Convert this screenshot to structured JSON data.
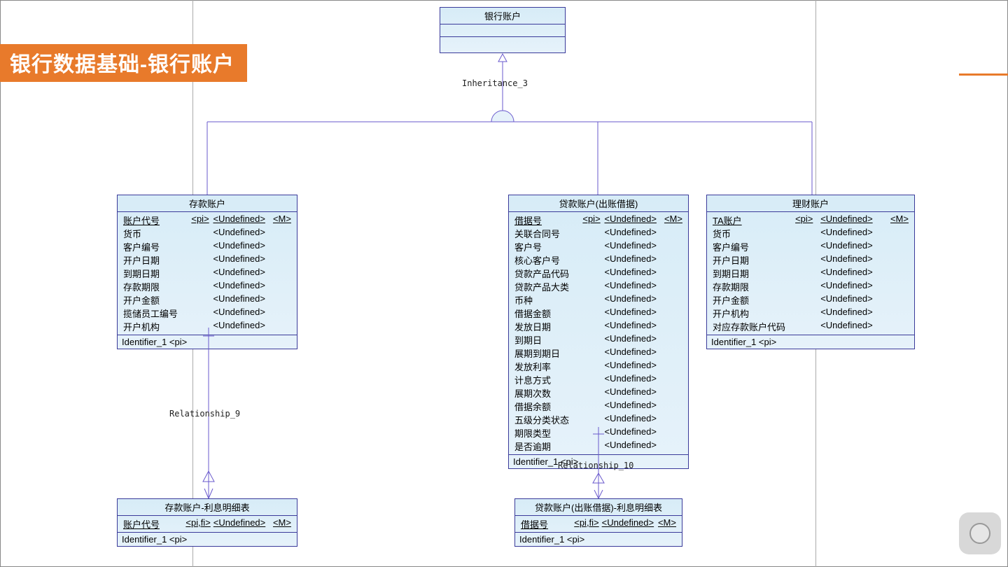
{
  "title": "银行数据基础-银行账户",
  "topEntity": {
    "name": "银行账户"
  },
  "inheritanceLabel": "Inheritance_3",
  "entities": {
    "deposit": {
      "name": "存款账户",
      "attrs": [
        {
          "name": "账户代号",
          "pi": "<pi>",
          "type": "<Undefined>",
          "m": "<M>",
          "key": true
        },
        {
          "name": "货币",
          "pi": "",
          "type": "<Undefined>",
          "m": ""
        },
        {
          "name": "客户编号",
          "pi": "",
          "type": "<Undefined>",
          "m": ""
        },
        {
          "name": "开户日期",
          "pi": "",
          "type": "<Undefined>",
          "m": ""
        },
        {
          "name": "到期日期",
          "pi": "",
          "type": "<Undefined>",
          "m": ""
        },
        {
          "name": "存款期限",
          "pi": "",
          "type": "<Undefined>",
          "m": ""
        },
        {
          "name": "开户金额",
          "pi": "",
          "type": "<Undefined>",
          "m": ""
        },
        {
          "name": "揽储员工编号",
          "pi": "",
          "type": "<Undefined>",
          "m": ""
        },
        {
          "name": "开户机构",
          "pi": "",
          "type": "<Undefined>",
          "m": ""
        }
      ],
      "ident": "Identifier_1  <pi>"
    },
    "loan": {
      "name": "贷款账户(出账借据)",
      "attrs": [
        {
          "name": "借据号",
          "pi": "<pi>",
          "type": "<Undefined>",
          "m": "<M>",
          "key": true
        },
        {
          "name": "关联合同号",
          "pi": "",
          "type": "<Undefined>",
          "m": ""
        },
        {
          "name": "客户号",
          "pi": "",
          "type": "<Undefined>",
          "m": ""
        },
        {
          "name": "核心客户号",
          "pi": "",
          "type": "<Undefined>",
          "m": ""
        },
        {
          "name": "贷款产品代码",
          "pi": "",
          "type": "<Undefined>",
          "m": ""
        },
        {
          "name": "贷款产品大类",
          "pi": "",
          "type": "<Undefined>",
          "m": ""
        },
        {
          "name": "币种",
          "pi": "",
          "type": "<Undefined>",
          "m": ""
        },
        {
          "name": "借据金额",
          "pi": "",
          "type": "<Undefined>",
          "m": ""
        },
        {
          "name": "发放日期",
          "pi": "",
          "type": "<Undefined>",
          "m": ""
        },
        {
          "name": "到期日",
          "pi": "",
          "type": "<Undefined>",
          "m": ""
        },
        {
          "name": "展期到期日",
          "pi": "",
          "type": "<Undefined>",
          "m": ""
        },
        {
          "name": "发放利率",
          "pi": "",
          "type": "<Undefined>",
          "m": ""
        },
        {
          "name": "计息方式",
          "pi": "",
          "type": "<Undefined>",
          "m": ""
        },
        {
          "name": "展期次数",
          "pi": "",
          "type": "<Undefined>",
          "m": ""
        },
        {
          "name": "借据余额",
          "pi": "",
          "type": "<Undefined>",
          "m": ""
        },
        {
          "name": "五级分类状态",
          "pi": "",
          "type": "<Undefined>",
          "m": ""
        },
        {
          "name": "期限类型",
          "pi": "",
          "type": "<Undefined>",
          "m": ""
        },
        {
          "name": "是否逾期",
          "pi": "",
          "type": "<Undefined>",
          "m": ""
        }
      ],
      "ident": "Identifier_1  <pi>"
    },
    "wealth": {
      "name": "理财账户",
      "attrs": [
        {
          "name": "TA账户",
          "pi": "<pi>",
          "type": "<Undefined>",
          "m": "<M>",
          "key": true
        },
        {
          "name": "货币",
          "pi": "",
          "type": "<Undefined>",
          "m": ""
        },
        {
          "name": "客户编号",
          "pi": "",
          "type": "<Undefined>",
          "m": ""
        },
        {
          "name": "开户日期",
          "pi": "",
          "type": "<Undefined>",
          "m": ""
        },
        {
          "name": "到期日期",
          "pi": "",
          "type": "<Undefined>",
          "m": ""
        },
        {
          "name": "存款期限",
          "pi": "",
          "type": "<Undefined>",
          "m": ""
        },
        {
          "name": "开户金额",
          "pi": "",
          "type": "<Undefined>",
          "m": ""
        },
        {
          "name": "开户机构",
          "pi": "",
          "type": "<Undefined>",
          "m": ""
        },
        {
          "name": "对应存款账户代码",
          "pi": "",
          "type": "<Undefined>",
          "m": ""
        }
      ],
      "ident": "Identifier_1  <pi>"
    },
    "depositDetail": {
      "name": "存款账户-利息明细表",
      "attrs": [
        {
          "name": "账户代号",
          "pi": "<pi,fi>",
          "type": "<Undefined>",
          "m": "<M>",
          "key": true
        }
      ],
      "ident": "Identifier_1  <pi>"
    },
    "loanDetail": {
      "name": "贷款账户(出账借据)-利息明细表",
      "attrs": [
        {
          "name": "借据号",
          "pi": "<pi,fi>",
          "type": "<Undefined>",
          "m": "<M>",
          "key": true
        }
      ],
      "ident": "Identifier_1  <pi>"
    }
  },
  "relations": {
    "rel9": "Relationship_9",
    "rel10": "Relationship_10"
  }
}
